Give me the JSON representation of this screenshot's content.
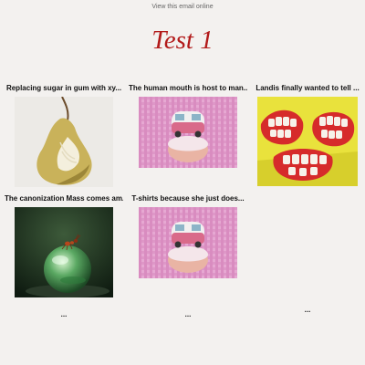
{
  "header": {
    "view_online": "View this email online",
    "title": "Test 1"
  },
  "articles": [
    {
      "caption": "Replacing sugar in gum with xy...",
      "image": "pear-image",
      "more": ""
    },
    {
      "caption": "The human mouth is host to man...",
      "image": "cupcake-van-image",
      "more": ""
    },
    {
      "caption": "Landis finally wanted to tell ...",
      "image": "apple-teeth-image",
      "more": ""
    },
    {
      "caption": "The canonization Mass comes am...",
      "image": "glass-ball-ant-image",
      "more": "..."
    },
    {
      "caption": "T-shirts because she just does...",
      "image": "cupcake-van-image",
      "more": "..."
    },
    {
      "caption": "",
      "image": "",
      "more": "..."
    }
  ],
  "colors": {
    "background": "#f3f1ef",
    "title": "#b21a1a"
  }
}
